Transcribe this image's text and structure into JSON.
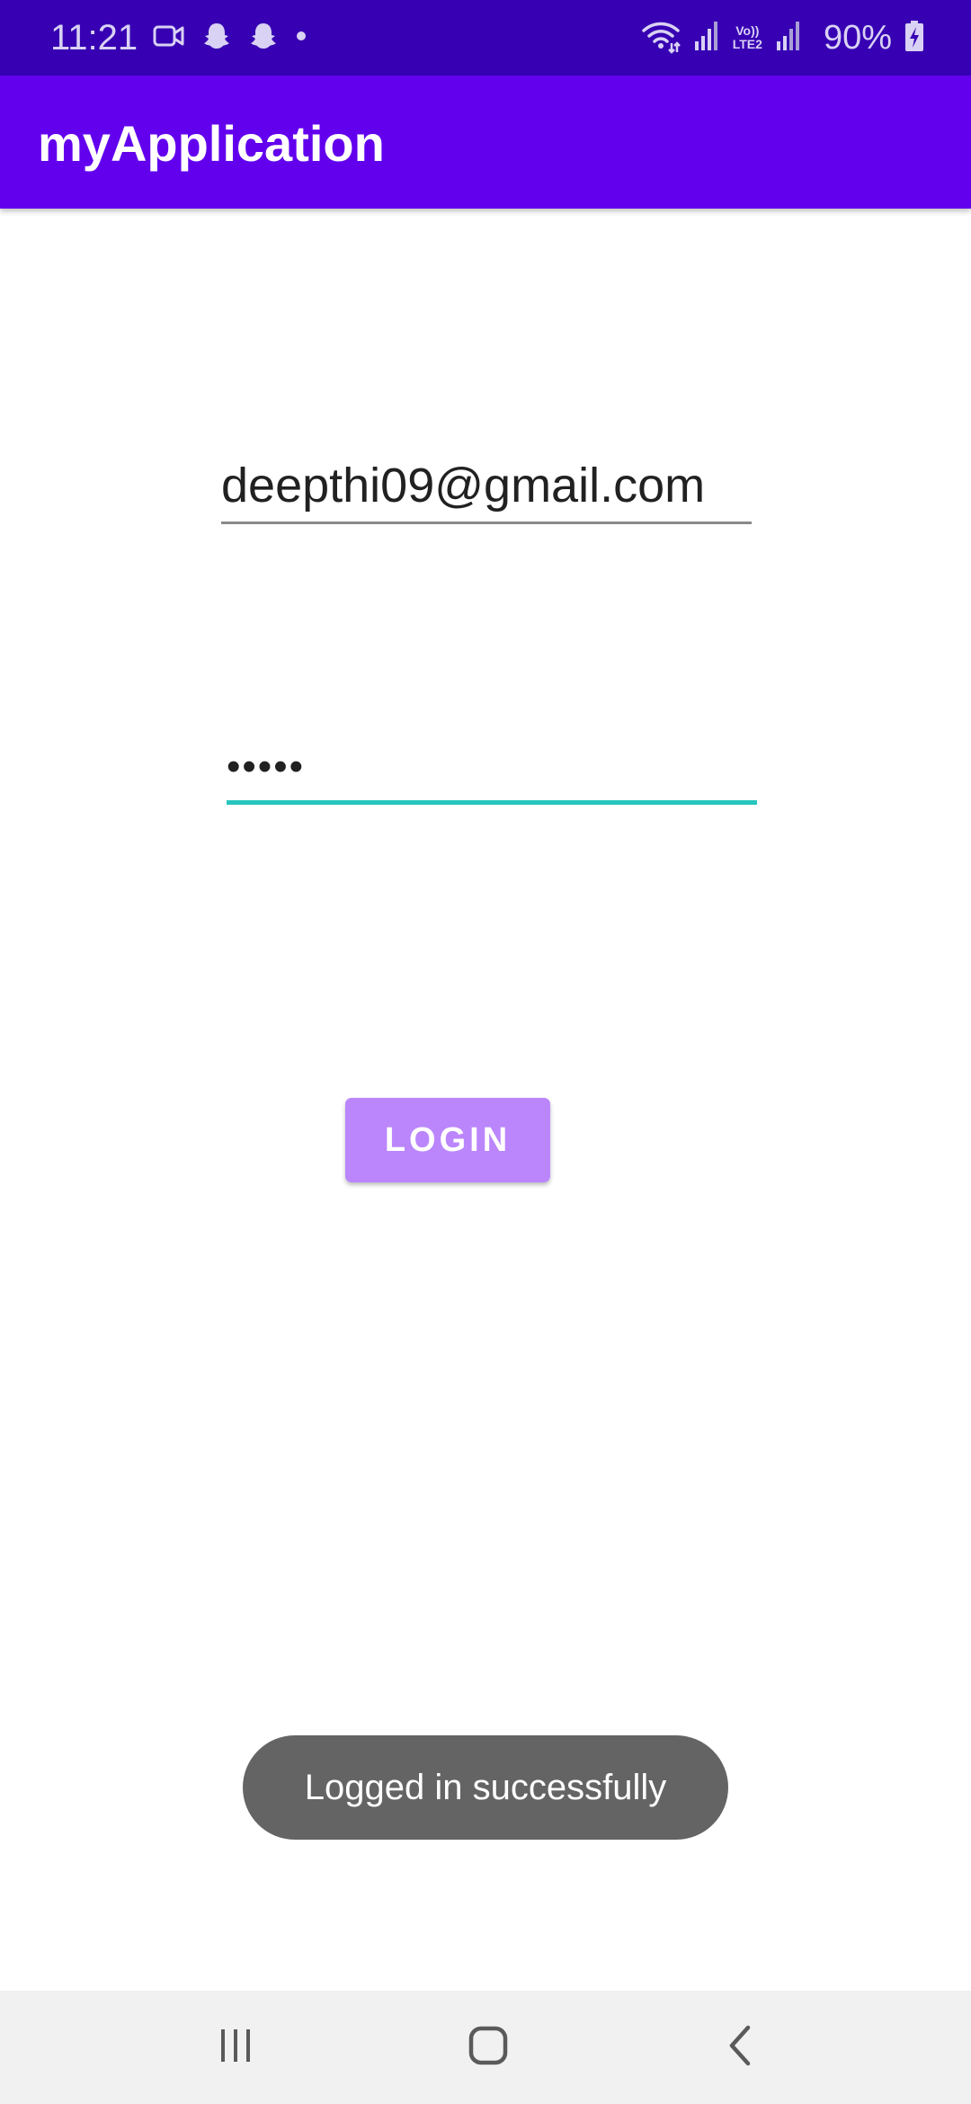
{
  "status_bar": {
    "time": "11:21",
    "battery": "90%",
    "lte_top": "Vo))",
    "lte_bottom": "LTE2",
    "left_icons": [
      "video-call-icon",
      "snapchat-icon",
      "snapchat-icon",
      "dot-icon"
    ],
    "right_icons": [
      "wifi-icon",
      "signal-icon",
      "signal-icon",
      "battery-charging-icon"
    ]
  },
  "app_bar": {
    "title": "myApplication"
  },
  "form": {
    "email_value": "deepthi09@gmail.com",
    "password_value": "•••••",
    "login_label": "LOGIN"
  },
  "toast": {
    "message": "Logged in successfully"
  },
  "nav_bar": {
    "items": [
      "recent-apps-icon",
      "home-icon",
      "back-icon"
    ]
  },
  "colors": {
    "status_bar": "#3700b3",
    "app_bar": "#6200ee",
    "login_button": "#bb86fc",
    "focused_underline": "#26c6bd",
    "toast": "#646464"
  }
}
